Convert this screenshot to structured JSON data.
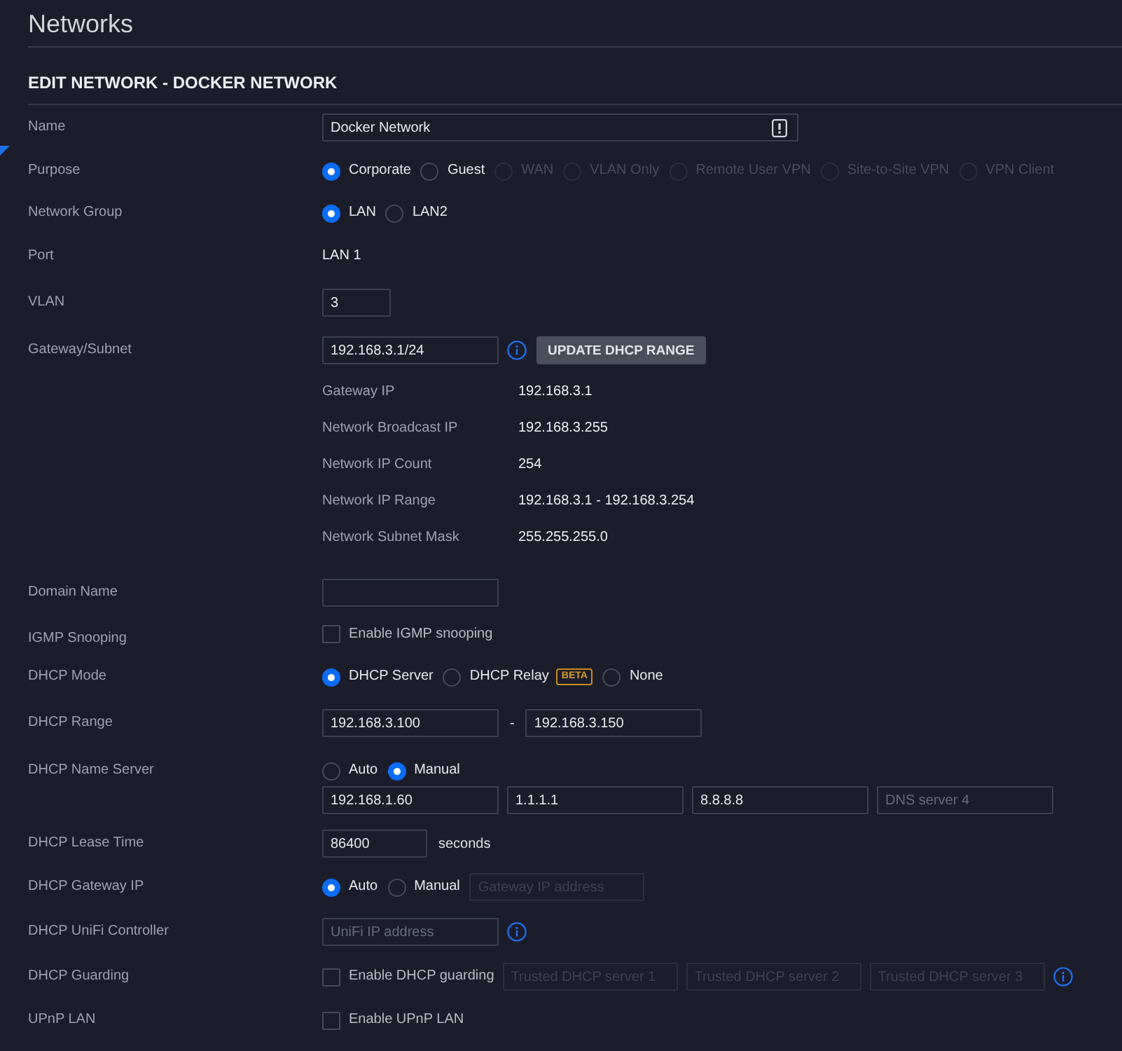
{
  "page": {
    "title": "Networks"
  },
  "section": {
    "title": "EDIT NETWORK - DOCKER NETWORK"
  },
  "form": {
    "name": {
      "label": "Name",
      "value": "Docker Network"
    },
    "purpose": {
      "label": "Purpose",
      "options": [
        {
          "label": "Corporate",
          "selected": true,
          "disabled": false
        },
        {
          "label": "Guest",
          "selected": false,
          "disabled": false
        },
        {
          "label": "WAN",
          "selected": false,
          "disabled": true
        },
        {
          "label": "VLAN Only",
          "selected": false,
          "disabled": true
        },
        {
          "label": "Remote User VPN",
          "selected": false,
          "disabled": true
        },
        {
          "label": "Site-to-Site VPN",
          "selected": false,
          "disabled": true
        },
        {
          "label": "VPN Client",
          "selected": false,
          "disabled": true
        }
      ]
    },
    "network_group": {
      "label": "Network Group",
      "options": [
        {
          "label": "LAN",
          "selected": true
        },
        {
          "label": "LAN2",
          "selected": false
        }
      ]
    },
    "port": {
      "label": "Port",
      "value": "LAN 1"
    },
    "vlan": {
      "label": "VLAN",
      "value": "3"
    },
    "gateway_subnet": {
      "label": "Gateway/Subnet",
      "value": "192.168.3.1/24",
      "button": "UPDATE DHCP RANGE"
    },
    "subnet_details": [
      {
        "label": "Gateway IP",
        "value": "192.168.3.1"
      },
      {
        "label": "Network Broadcast IP",
        "value": "192.168.3.255"
      },
      {
        "label": "Network IP Count",
        "value": "254"
      },
      {
        "label": "Network IP Range",
        "value": "192.168.3.1 - 192.168.3.254"
      },
      {
        "label": "Network Subnet Mask",
        "value": "255.255.255.0"
      }
    ],
    "domain_name": {
      "label": "Domain Name"
    },
    "igmp_snooping": {
      "label": "IGMP Snooping",
      "checkbox": {
        "label": "Enable IGMP snooping",
        "checked": false
      }
    },
    "dhcp_mode": {
      "label": "DHCP Mode",
      "options": [
        {
          "label": "DHCP Server",
          "selected": true
        },
        {
          "label": "DHCP Relay",
          "selected": false,
          "badge": "BETA"
        },
        {
          "label": "None",
          "selected": false
        }
      ]
    },
    "dhcp_range": {
      "label": "DHCP Range",
      "start": "192.168.3.100",
      "separator": "-",
      "end": "192.168.3.150"
    },
    "dhcp_name_server": {
      "label": "DHCP Name Server",
      "options": [
        {
          "label": "Auto",
          "selected": false
        },
        {
          "label": "Manual",
          "selected": true
        }
      ],
      "servers": [
        {
          "value": "192.168.1.60"
        },
        {
          "value": "1.1.1.1"
        },
        {
          "value": "8.8.8.8"
        },
        {
          "placeholder": "DNS server 4"
        }
      ]
    },
    "dhcp_lease_time": {
      "label": "DHCP Lease Time",
      "value": "86400",
      "unit": "seconds"
    },
    "dhcp_gateway_ip": {
      "label": "DHCP Gateway IP",
      "options": [
        {
          "label": "Auto",
          "selected": true
        },
        {
          "label": "Manual",
          "selected": false
        }
      ],
      "address": {
        "placeholder": "Gateway IP address",
        "disabled": true
      }
    },
    "dhcp_unifi_controller": {
      "label": "DHCP UniFi Controller",
      "address": {
        "placeholder": "UniFi IP address"
      }
    },
    "dhcp_guarding": {
      "label": "DHCP Guarding",
      "checkbox": {
        "label": "Enable DHCP guarding",
        "checked": false
      },
      "servers": [
        {
          "placeholder": "Trusted DHCP server 1",
          "disabled": true
        },
        {
          "placeholder": "Trusted DHCP server 2",
          "disabled": true
        },
        {
          "placeholder": "Trusted DHCP server 3",
          "disabled": true
        }
      ]
    },
    "upnp_lan": {
      "label": "UPnP LAN",
      "checkbox": {
        "label": "Enable UPnP LAN",
        "checked": false
      }
    }
  }
}
